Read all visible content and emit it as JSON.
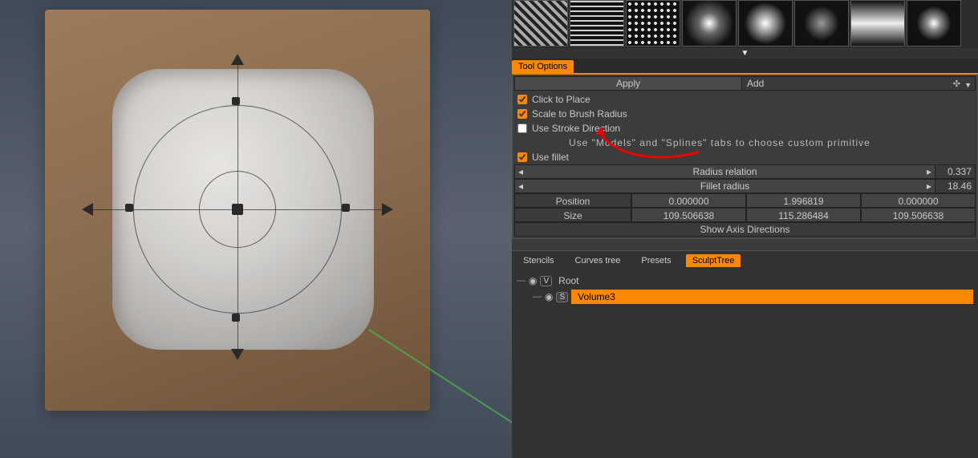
{
  "tool_options": {
    "tab_label": "Tool Options",
    "apply_label": "Apply",
    "add_label": "Add",
    "click_to_place": "Click to Place",
    "scale_to_brush": "Scale to Brush Radius",
    "use_stroke_dir": "Use Stroke Direction",
    "hint": "Use \"Models\" and \"Splines\" tabs to choose custom primitive",
    "use_fillet": "Use fillet",
    "radius_relation_label": "Radius relation",
    "radius_relation_value": "0.337",
    "fillet_radius_label": "Fillet radius",
    "fillet_radius_value": "18.46",
    "position_label": "Position",
    "position": [
      "0.000000",
      "1.996819",
      "0.000000"
    ],
    "size_label": "Size",
    "size": [
      "109.506638",
      "115.286484",
      "109.506638"
    ],
    "show_axis": "Show Axis Directions"
  },
  "tree": {
    "tabs": [
      "Stencils",
      "Curves tree",
      "Presets",
      "SculptTree"
    ],
    "root_label": "Root",
    "volume_label": "Volume3"
  }
}
